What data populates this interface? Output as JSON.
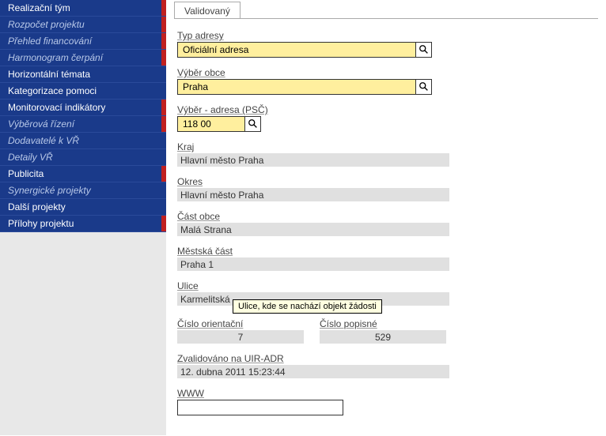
{
  "sidebar": {
    "items": [
      {
        "label": "Realizační tým",
        "italic": false,
        "red": true
      },
      {
        "label": "Rozpočet projektu",
        "italic": true,
        "red": true
      },
      {
        "label": "Přehled financování",
        "italic": true,
        "red": true
      },
      {
        "label": "Harmonogram čerpání",
        "italic": true,
        "red": true
      },
      {
        "label": "Horizontální témata",
        "italic": false,
        "red": false
      },
      {
        "label": "Kategorizace pomoci",
        "italic": false,
        "red": false
      },
      {
        "label": "Monitorovací indikátory",
        "italic": false,
        "red": true
      },
      {
        "label": "Výběrová řízení",
        "italic": true,
        "red": true
      },
      {
        "label": "Dodavatelé k VŘ",
        "italic": true,
        "red": false
      },
      {
        "label": "Detaily VŘ",
        "italic": true,
        "red": false
      },
      {
        "label": "Publicita",
        "italic": false,
        "red": true
      },
      {
        "label": "Synergické projekty",
        "italic": true,
        "red": false
      },
      {
        "label": "Další projekty",
        "italic": false,
        "red": false
      },
      {
        "label": "Přílohy projektu",
        "italic": false,
        "red": true
      }
    ]
  },
  "tab": {
    "label": "Validovaný"
  },
  "fields": {
    "typ_adresy": {
      "label": "Typ adresy",
      "value": "Oficiální adresa"
    },
    "vyber_obce": {
      "label": "Výběr obce",
      "value": "Praha"
    },
    "vyber_psc": {
      "label": "Výběr - adresa (PSČ)",
      "value": "118 00"
    },
    "kraj": {
      "label": "Kraj",
      "value": "Hlavní město Praha"
    },
    "okres": {
      "label": "Okres",
      "value": "Hlavní město Praha"
    },
    "cast_obce": {
      "label": "Část obce",
      "value": "Malá Strana"
    },
    "mestska_cast": {
      "label": "Městská část",
      "value": "Praha 1"
    },
    "ulice": {
      "label": "Ulice",
      "value": "Karmelitská"
    },
    "cislo_orientacni": {
      "label": "Číslo orientační",
      "value": "7"
    },
    "cislo_popisne": {
      "label": "Číslo popisné",
      "value": "529"
    },
    "zvalidovano": {
      "label": "Zvalidováno na UIR-ADR",
      "value": "12. dubna 2011 15:23:44"
    },
    "www": {
      "label": "WWW",
      "value": ""
    }
  },
  "tooltip": {
    "text": "Ulice, kde se nachází objekt žádosti"
  }
}
